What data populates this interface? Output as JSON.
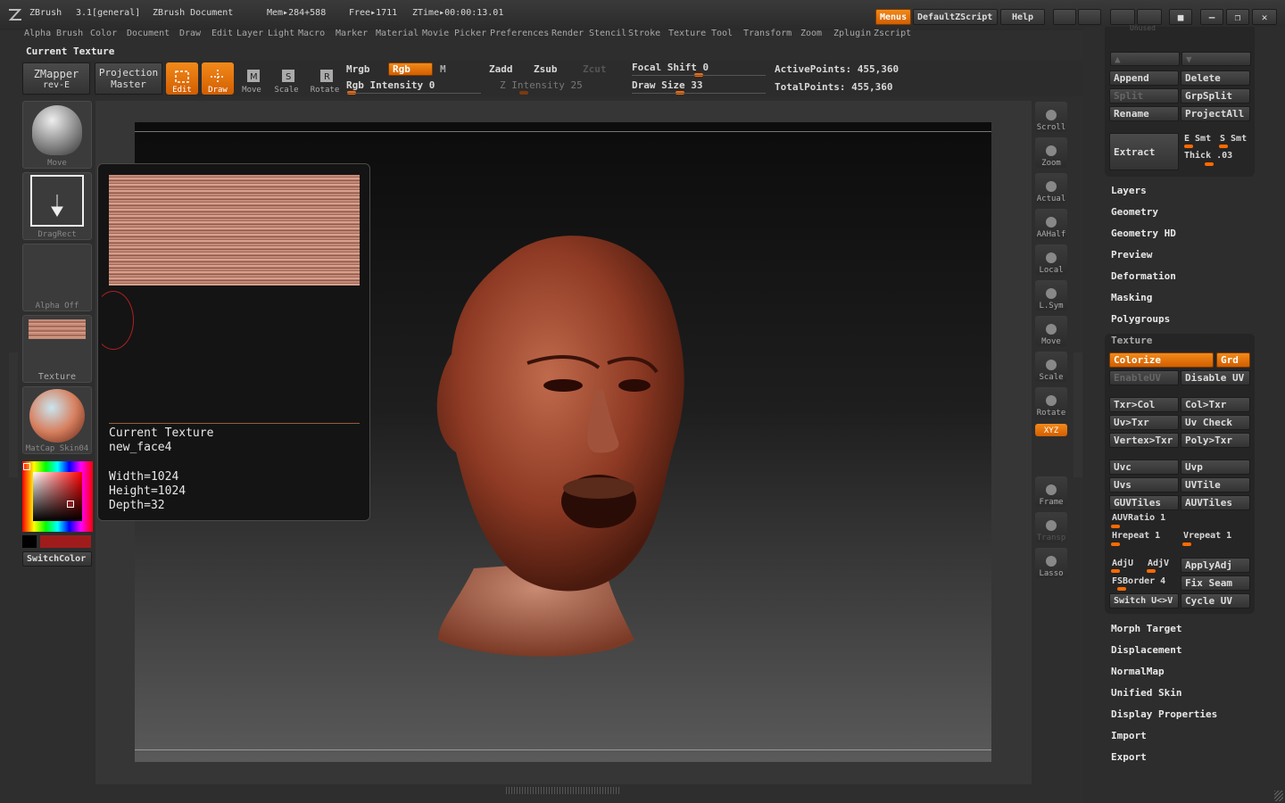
{
  "title_bar": {
    "app": "ZBrush",
    "version": "3.1[general]",
    "document": "ZBrush Document",
    "mem": "Mem▸284+588",
    "free": "Free▸1711",
    "ztime": "ZTime▸00:00:13.01",
    "menus_label": "Menus",
    "script_label": "DefaultZScript",
    "help_label": "Help"
  },
  "menu_bar": [
    "Alpha",
    "Brush",
    "Color",
    "Document",
    "Draw",
    "Edit",
    "Layer",
    "Light",
    "Macro",
    "Marker",
    "Material",
    "Movie",
    "Picker",
    "Preferences",
    "Render",
    "Stencil",
    "Stroke",
    "Texture",
    "Tool",
    "Transform",
    "Zoom",
    "Zplugin",
    "Zscript"
  ],
  "palette_title": "Current Texture",
  "top_toolbar": {
    "zmapper": "ZMapper",
    "zmapper_sub": "rev-E",
    "projection": "Projection",
    "projection_sub": "Master",
    "edit": "Edit",
    "draw": "Draw",
    "move": "Move",
    "scale": "Scale",
    "rotate": "Rotate",
    "mrgb": "Mrgb",
    "rgb": "Rgb",
    "m": "M",
    "rgb_intensity": "Rgb Intensity 0",
    "zadd": "Zadd",
    "zsub": "Zsub",
    "zcut": "Zcut",
    "z_intensity": "Z Intensity 25",
    "focal_shift": "Focal Shift 0",
    "draw_size": "Draw Size 33",
    "active_points": "ActivePoints: 455,360",
    "total_points": "TotalPoints: 455,360"
  },
  "left_shelf": {
    "move": "Move",
    "dragrect": "DragRect",
    "alpha": "Alpha Off",
    "texture": "Texture",
    "matcap": "MatCap Skin04",
    "switch_color": "SwitchColor"
  },
  "texture_popup": {
    "heading": "Current Texture",
    "name": "new_face4",
    "width": "Width=1024",
    "height": "Height=1024",
    "depth": "Depth=32"
  },
  "right_tools": [
    "Scroll",
    "Zoom",
    "Actual",
    "AAHalf",
    "Local",
    "L.Sym",
    "Move",
    "Scale",
    "Rotate",
    "XYZ",
    "Frame",
    "Transp",
    "Lasso"
  ],
  "right_panel": {
    "unused": "Unused",
    "append": "Append",
    "delete": "Delete",
    "split": "Split",
    "grpsplit": "GrpSplit",
    "rename": "Rename",
    "projectall": "ProjectAll",
    "extract": "Extract",
    "esmt": "E Smt",
    "ssmt": "S Smt",
    "thick": "Thick .03",
    "sections_top": [
      "Layers",
      "Geometry",
      "Geometry HD",
      "Preview",
      "Deformation",
      "Masking",
      "Polygroups"
    ],
    "texture_header": "Texture",
    "colorize": "Colorize",
    "grd": "Grd",
    "enableuv": "EnableUV",
    "disableuv": "Disable UV",
    "txr_col": "Txr>Col",
    "col_txr": "Col>Txr",
    "uv_txr": "Uv>Txr",
    "uv_check": "Uv Check",
    "vertex_txr": "Vertex>Txr",
    "poly_txr": "Poly>Txr",
    "uvc": "Uvc",
    "uvp": "Uvp",
    "uvs": "Uvs",
    "uvtile": "UVTile",
    "guvtiles": "GUVTiles",
    "auvtiles": "AUVTiles",
    "auvratio": "AUVRatio 1",
    "hrepeat": "Hrepeat 1",
    "vrepeat": "Vrepeat 1",
    "adju": "AdjU",
    "adjv": "AdjV",
    "applyadj": "ApplyAdj",
    "fsborder": "FSBorder 4",
    "fixseam": "Fix Seam",
    "switch_uv": "Switch U<>V",
    "cycle_uv": "Cycle UV",
    "sections_bottom": [
      "Morph Target",
      "Displacement",
      "NormalMap",
      "Unified Skin",
      "Display Properties",
      "Import",
      "Export"
    ]
  }
}
